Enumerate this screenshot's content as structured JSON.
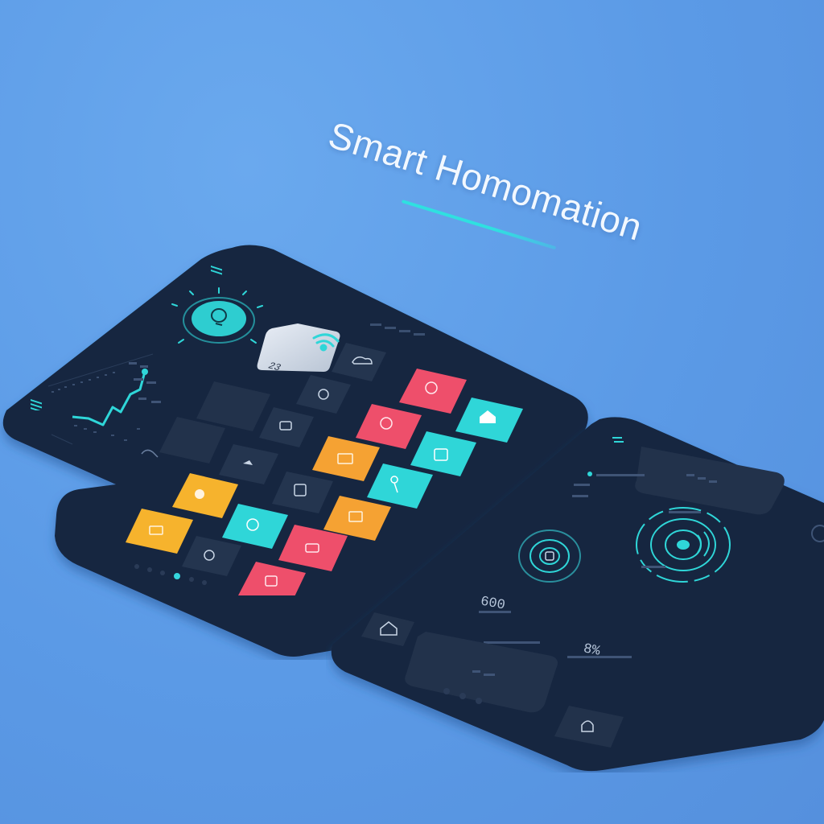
{
  "title": "Smart Homomation",
  "colors": {
    "background": "#5b9ae6",
    "panel": "#172640",
    "tile_dark": "#24354f",
    "accent_cyan": "#2fd6d8",
    "accent_red": "#ee4f6b",
    "accent_orange": "#f5a233",
    "accent_yellow": "#f6b32d"
  },
  "main_panel": {
    "mode_label": "23",
    "pagination": {
      "count": 6,
      "active_index": 3
    }
  },
  "right_panel": {
    "reading_left": "600",
    "reading_right": "8%",
    "pagination": {
      "count": 3,
      "active_index": 0
    }
  }
}
